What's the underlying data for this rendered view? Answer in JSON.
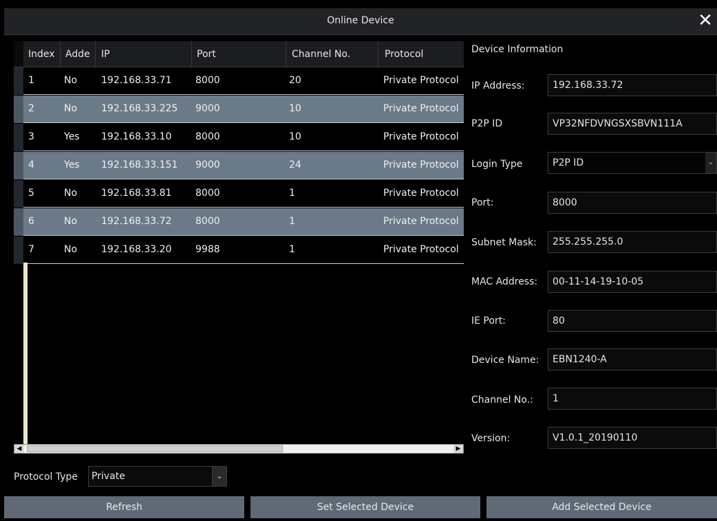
{
  "window": {
    "title": "Online Device",
    "close_icon": "close-icon"
  },
  "table": {
    "columns": [
      "Index",
      "Adde",
      "IP",
      "Port",
      "Channel No.",
      "Protocol"
    ],
    "rows": [
      {
        "index": "1",
        "added": "No",
        "ip": "192.168.33.71",
        "port": "8000",
        "channel": "20",
        "protocol": "Private Protocol"
      },
      {
        "index": "2",
        "added": "No",
        "ip": "192.168.33.225",
        "port": "9000",
        "channel": "10",
        "protocol": "Private Protocol"
      },
      {
        "index": "3",
        "added": "Yes",
        "ip": "192.168.33.10",
        "port": "8000",
        "channel": "10",
        "protocol": "Private Protocol"
      },
      {
        "index": "4",
        "added": "Yes",
        "ip": "192.168.33.151",
        "port": "9000",
        "channel": "24",
        "protocol": "Private Protocol"
      },
      {
        "index": "5",
        "added": "No",
        "ip": "192.168.33.81",
        "port": "8000",
        "channel": "1",
        "protocol": "Private Protocol"
      },
      {
        "index": "6",
        "added": "No",
        "ip": "192.168.33.72",
        "port": "8000",
        "channel": "1",
        "protocol": "Private Protocol"
      },
      {
        "index": "7",
        "added": "No",
        "ip": "192.168.33.20",
        "port": "9988",
        "channel": "1",
        "protocol": "Private Protocol"
      }
    ]
  },
  "info": {
    "title": "Device Information",
    "fields": {
      "ip_address": {
        "label": "IP Address:",
        "value": "192.168.33.72"
      },
      "p2p_id": {
        "label": "P2P ID",
        "value": "VP32NFDVNGSXSBVN111A"
      },
      "login_type": {
        "label": "Login Type",
        "value": "P2P ID"
      },
      "port": {
        "label": "Port:",
        "value": "8000"
      },
      "subnet_mask": {
        "label": "Subnet Mask:",
        "value": "255.255.255.0"
      },
      "mac_address": {
        "label": "MAC Address:",
        "value": "00-11-14-19-10-05"
      },
      "ie_port": {
        "label": "IE Port:",
        "value": "80"
      },
      "device_name": {
        "label": "Device Name:",
        "value": "EBN1240-A"
      },
      "channel_no": {
        "label": "Channel No.:",
        "value": "1"
      },
      "version": {
        "label": "Version:",
        "value": "V1.0.1_20190110"
      }
    }
  },
  "bottom": {
    "protocol_label": "Protocol Type",
    "protocol_value": "Private",
    "buttons": {
      "refresh": "Refresh",
      "set_selected": "Set Selected Device",
      "add_selected": "Add Selected Device"
    }
  },
  "colors": {
    "row_highlight": "#6b7a88",
    "button": "#5f6a77",
    "background": "#000000"
  }
}
